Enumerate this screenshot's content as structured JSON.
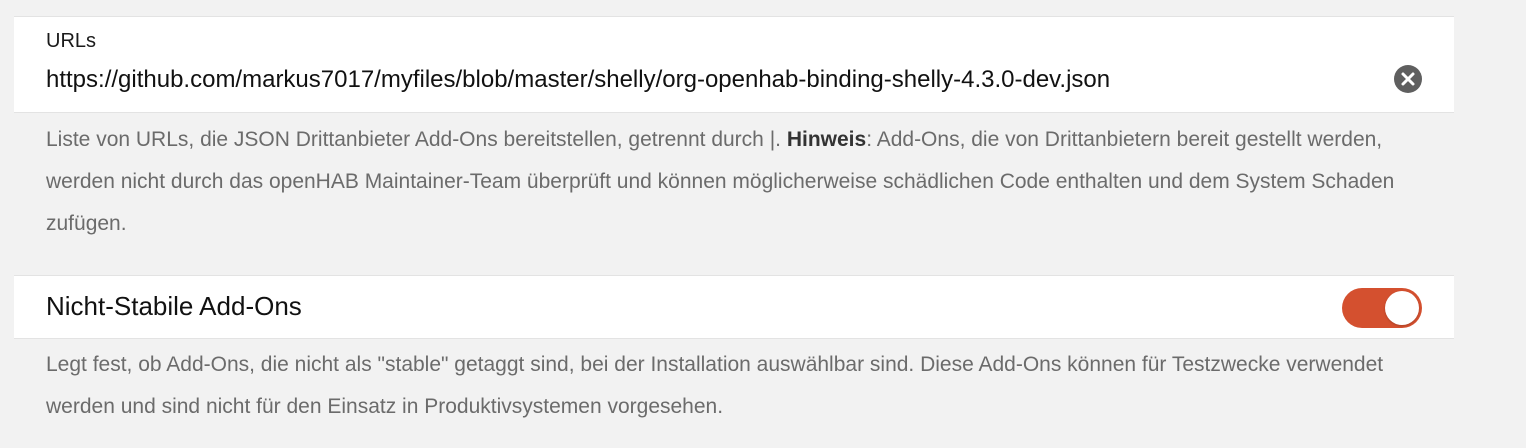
{
  "urls_setting": {
    "label": "URLs",
    "value": "https://github.com/markus7017/myfiles/blob/master/shelly/org-openhab-binding-shelly-4.3.0-dev.json",
    "clear_icon": "clear-icon",
    "description_before": "Liste von URLs, die JSON Drittanbieter Add-Ons bereitstellen, getrennt durch |. ",
    "description_bold": "Hinweis",
    "description_after": ": Add-Ons, die von Drittanbietern bereit gestellt werden, werden nicht durch das openHAB Maintainer-Team überprüft und können möglicherweise schädlichen Code enthalten und dem System Schaden zufügen."
  },
  "unstable_setting": {
    "title": "Nicht-Stabile Add-Ons",
    "enabled": true,
    "toggle_color": "#d4502f",
    "description": "Legt fest, ob Add-Ons, die nicht als \"stable\" getaggt sind, bei der Installation auswählbar sind. Diese Add-Ons können für Testzwecke verwendet werden und sind nicht für den Einsatz in Produktivsystemen vorgesehen."
  }
}
